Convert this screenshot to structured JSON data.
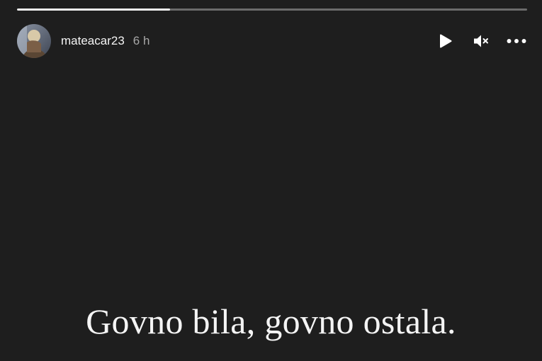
{
  "story": {
    "progress_fraction": 0.3,
    "colors": {
      "background": "#1e1e1e",
      "progress_fill": "#f2f2f2",
      "progress_track": "#6b6b6b",
      "text": "#f4f4f4",
      "muted_text": "#a8a8a8"
    }
  },
  "header": {
    "avatar_icon": "user-avatar",
    "username": "mateacar23",
    "timestamp": "6 h"
  },
  "controls": {
    "play_icon": "play-icon",
    "mute_icon": "speaker-muted-icon",
    "more_icon": "more-options-icon"
  },
  "caption": {
    "text": "Govno bila, govno ostala."
  }
}
